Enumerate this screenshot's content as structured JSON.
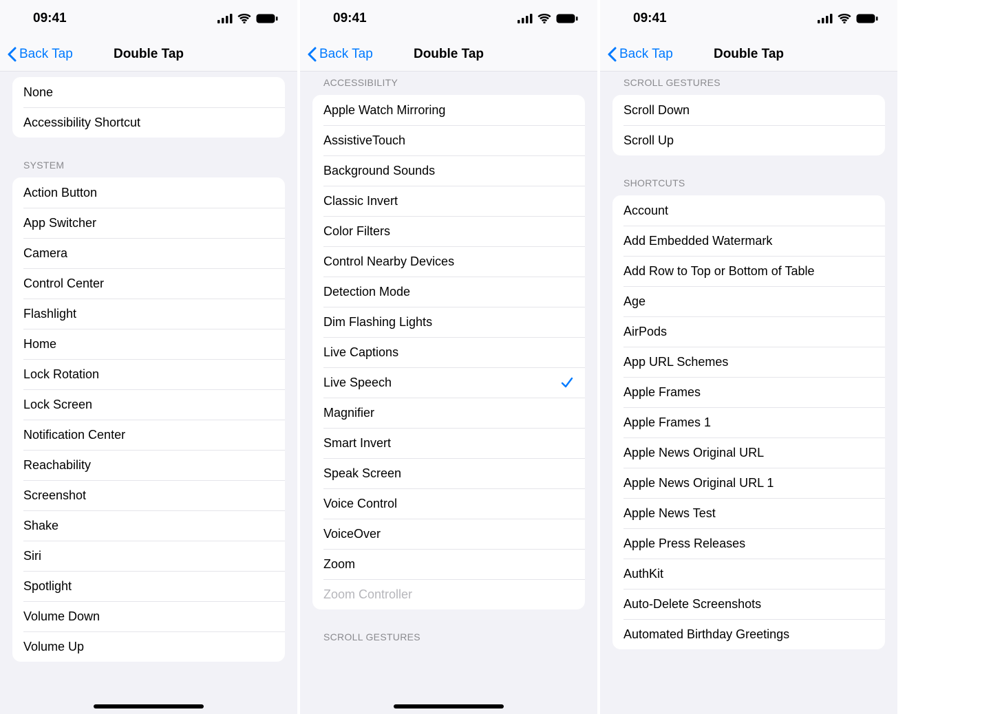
{
  "status": {
    "time": "09:41"
  },
  "nav": {
    "back_label": "Back Tap",
    "title": "Double Tap"
  },
  "phone1": {
    "top_group": {
      "items": [
        {
          "label": "None"
        },
        {
          "label": "Accessibility Shortcut"
        }
      ]
    },
    "section_system": {
      "header": "SYSTEM",
      "items": [
        {
          "label": "Action Button"
        },
        {
          "label": "App Switcher"
        },
        {
          "label": "Camera"
        },
        {
          "label": "Control Center"
        },
        {
          "label": "Flashlight"
        },
        {
          "label": "Home"
        },
        {
          "label": "Lock Rotation"
        },
        {
          "label": "Lock Screen"
        },
        {
          "label": "Notification Center"
        },
        {
          "label": "Reachability"
        },
        {
          "label": "Screenshot"
        },
        {
          "label": "Shake"
        },
        {
          "label": "Siri"
        },
        {
          "label": "Spotlight"
        },
        {
          "label": "Volume Down"
        },
        {
          "label": "Volume Up"
        }
      ]
    }
  },
  "phone2": {
    "section_accessibility": {
      "header": "ACCESSIBILITY",
      "items": [
        {
          "label": "Apple Watch Mirroring"
        },
        {
          "label": "AssistiveTouch"
        },
        {
          "label": "Background Sounds"
        },
        {
          "label": "Classic Invert"
        },
        {
          "label": "Color Filters"
        },
        {
          "label": "Control Nearby Devices"
        },
        {
          "label": "Detection Mode"
        },
        {
          "label": "Dim Flashing Lights"
        },
        {
          "label": "Live Captions"
        },
        {
          "label": "Live Speech",
          "checked": true
        },
        {
          "label": "Magnifier"
        },
        {
          "label": "Smart Invert"
        },
        {
          "label": "Speak Screen"
        },
        {
          "label": "Voice Control"
        },
        {
          "label": "VoiceOver"
        },
        {
          "label": "Zoom"
        },
        {
          "label": "Zoom Controller",
          "disabled": true
        }
      ]
    },
    "section_scroll_gestures": {
      "header": "SCROLL GESTURES"
    }
  },
  "phone3": {
    "section_scroll_gestures": {
      "header": "SCROLL GESTURES"
    },
    "scroll_group": {
      "items": [
        {
          "label": "Scroll Down"
        },
        {
          "label": "Scroll Up"
        }
      ]
    },
    "section_shortcuts": {
      "header": "SHORTCUTS",
      "items": [
        {
          "label": "Account"
        },
        {
          "label": "Add Embedded Watermark"
        },
        {
          "label": "Add Row to Top or Bottom of Table"
        },
        {
          "label": "Age"
        },
        {
          "label": "AirPods"
        },
        {
          "label": "App URL Schemes"
        },
        {
          "label": "Apple Frames"
        },
        {
          "label": "Apple Frames 1"
        },
        {
          "label": "Apple News Original URL"
        },
        {
          "label": "Apple News Original URL 1"
        },
        {
          "label": "Apple News Test"
        },
        {
          "label": "Apple Press Releases"
        },
        {
          "label": "AuthKit"
        },
        {
          "label": "Auto-Delete Screenshots"
        },
        {
          "label": "Automated Birthday Greetings"
        }
      ]
    }
  }
}
